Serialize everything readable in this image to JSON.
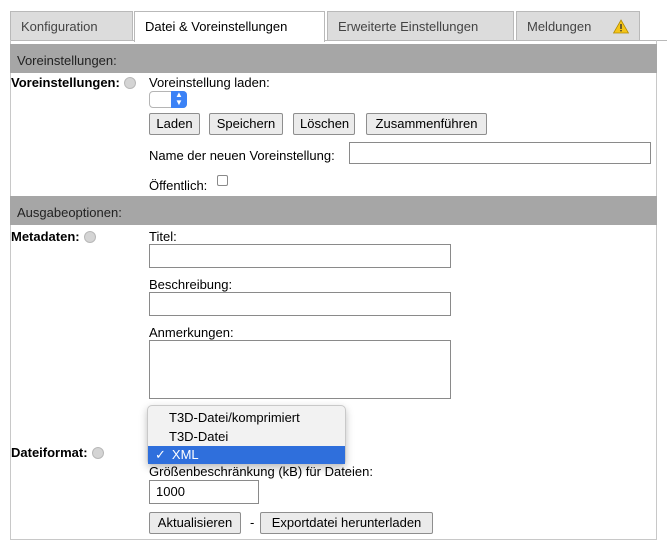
{
  "tabs": [
    {
      "label": "Konfiguration",
      "active": false
    },
    {
      "label": "Datei & Voreinstellungen",
      "active": true
    },
    {
      "label": "Erweiterte Einstellungen",
      "active": false
    },
    {
      "label": "Meldungen",
      "active": false
    }
  ],
  "presets": {
    "section_title": "Voreinstellungen:",
    "row_label": "Voreinstellungen:",
    "load_label": "Voreinstellung laden:",
    "buttons": {
      "load": "Laden",
      "save": "Speichern",
      "delete": "Löschen",
      "merge": "Zusammenführen"
    },
    "new_name_label": "Name der neuen Voreinstellung:",
    "new_name_value": "",
    "public_label": "Öffentlich:"
  },
  "output": {
    "section_title": "Ausgabeoptionen:",
    "metadata_label": "Metadaten:",
    "title_label": "Titel:",
    "title_value": "",
    "description_label": "Beschreibung:",
    "description_value": "",
    "notes_label": "Anmerkungen:",
    "notes_value": "",
    "fileformat_label": "Dateiformat:",
    "format_options": [
      "T3D-Datei/komprimiert",
      "T3D-Datei",
      "XML"
    ],
    "format_selected": "XML",
    "check_glyph": "✓",
    "size_limit_label": "Größenbeschränkung (kB) für Dateien:",
    "size_limit_value": "1000",
    "update_button": "Aktualisieren",
    "separator": "-",
    "download_button": "Exportdatei herunterladen"
  },
  "colors": {
    "section_bg": "#a6a6a6",
    "tab_bg": "#dcdcdc",
    "selected_option": "#2f6fdc",
    "warning": "#f5c518"
  }
}
